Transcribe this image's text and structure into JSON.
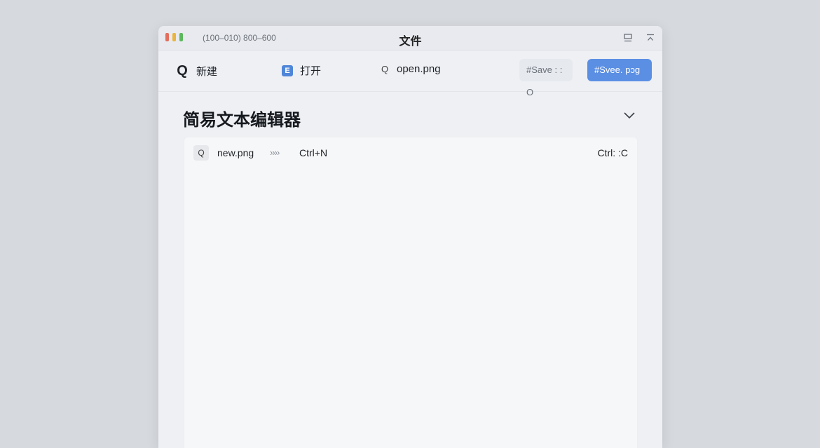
{
  "window": {
    "title": "文件",
    "meta": "(100–010) 800–600"
  },
  "toolbar": {
    "new_label": "新建",
    "open_label": "打开",
    "open_icon_glyph": "E",
    "file_label": "open.png",
    "save_ghost_label": "#Save : : O",
    "save_primary_label": "#Svee. pɔg"
  },
  "editor": {
    "title": "简易文本编辑器",
    "row": {
      "icon_glyph": "Q",
      "filename": "new.png",
      "arrows": "››››",
      "shortcut": "Ctrl+N",
      "right_shortcut": "Ctrl: :C"
    }
  },
  "icons": {
    "new": "search-icon",
    "open": "open-file-icon",
    "file": "search-icon",
    "chevron": "chevron-down-icon",
    "minimize": "window-minimize-icon",
    "collapse": "window-collapse-icon"
  },
  "colors": {
    "accent": "#5b8fe4",
    "traffic_red": "#e46e5c",
    "traffic_yellow": "#e9b43f",
    "traffic_green": "#5cb85c"
  }
}
